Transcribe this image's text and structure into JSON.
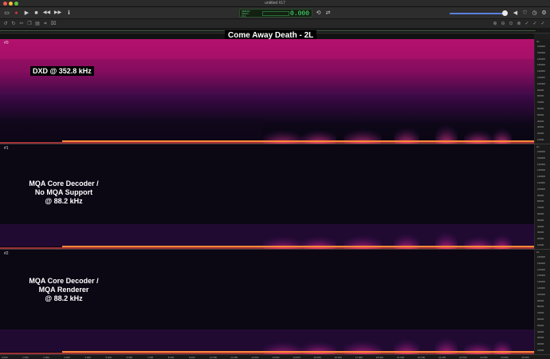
{
  "window": {
    "title": "untitled #17"
  },
  "toolbar": {
    "lcd_small_1": "384kHz",
    "lcd_small_2": "32bit",
    "lcd_small_3": "Flt",
    "lcd_time": "0.000"
  },
  "document": {
    "title": "Come Away Death - 2L"
  },
  "tracks": [
    {
      "label": "#0",
      "overlay": "DXD @ 352.8 kHz"
    },
    {
      "label": "#1",
      "overlay_lines": [
        "MQA Core Decoder /",
        "No MQA Support",
        "@ 88.2 kHz"
      ]
    },
    {
      "label": "#2",
      "overlay_lines": [
        "MQA Core Decoder /",
        "MQA Renderer",
        "@ 88.2 kHz"
      ]
    }
  ],
  "freq_axis": {
    "unit": "Hz",
    "ticks": [
      "160000",
      "150000",
      "140000",
      "130000",
      "120000",
      "110000",
      "100000",
      "90000",
      "80000",
      "70000",
      "60000",
      "50000",
      "40000",
      "30000",
      "20000",
      "10000"
    ]
  },
  "time_axis": {
    "ticks": [
      "0.000",
      "1.000",
      "2.000",
      "3.000",
      "4.000",
      "5.000",
      "6.000",
      "7.000",
      "8.000",
      "9.000",
      "10.000",
      "11.000",
      "12.000",
      "13.000",
      "14.000",
      "15.000",
      "16.000",
      "17.000",
      "18.000",
      "19.000",
      "20.000",
      "21.000",
      "22.000",
      "23.000",
      "24.000",
      "25.000"
    ]
  },
  "colors": {
    "spectrum_hot": "#ff6a2a",
    "spectrum_mid": "#b0207a",
    "spectrum_low": "#3a0e55",
    "background": "#0b0713"
  }
}
